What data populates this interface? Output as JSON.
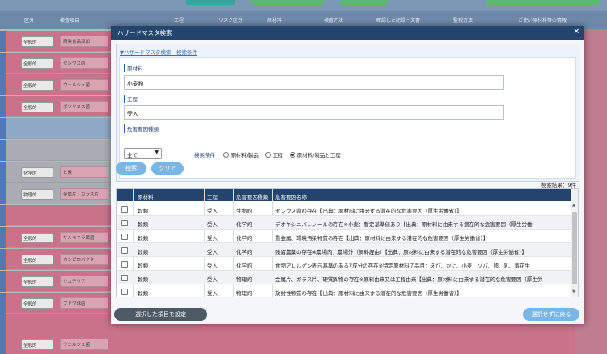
{
  "background": {
    "header_cols": [
      "区分",
      "検査項目",
      "工程",
      "リスク区分",
      "原材料",
      "検査方法",
      "確認した記録・文書",
      "監視方法",
      "ご使い原材料等の情報"
    ],
    "rows": [
      {
        "select": "全般的",
        "cell": "商業食品添加"
      },
      {
        "select": "全般的",
        "cell": "セレウス菌"
      },
      {
        "select": "全般的",
        "cell": "ウェルシュ菌"
      },
      {
        "select": "全般的",
        "cell": "ボツリヌス菌"
      },
      {
        "select": "化学的",
        "cell": "ヒ素"
      },
      {
        "select": "物理的",
        "cell": "金属片・ガラス片"
      },
      {
        "select": "全般的",
        "cell": "サルモネラ属菌"
      },
      {
        "select": "全般的",
        "cell": "カンピロバクター"
      },
      {
        "select": "全般的",
        "cell": "リステリア"
      },
      {
        "select": "全般的",
        "cell": "ブドウ球菌"
      },
      {
        "select": "全般的",
        "cell": "ウェルシュ菌"
      }
    ]
  },
  "dialog": {
    "title": "ハザードマスタ検索",
    "close": "×",
    "cond_toggle": "▼ハザードマスタ検索　検索条件",
    "material_label": "原材料",
    "material_value": "小麦粉",
    "process_label": "工程",
    "process_value": "受入",
    "hazard_type_label": "危害要因種類",
    "hazard_type_value": "全て",
    "search_cond_label": "検索条件",
    "radios": [
      {
        "label": "原材料/製品",
        "checked": false
      },
      {
        "label": "工程",
        "checked": false
      },
      {
        "label": "原材料/製品と工程",
        "checked": true
      }
    ],
    "search_button": "検索",
    "clear_button": "クリア",
    "result_count": "検索結果：9件",
    "table": {
      "headers": [
        "",
        "原材料",
        "工程",
        "危害要因種類",
        "危害要因名称"
      ],
      "rows": [
        {
          "material": "穀類",
          "process": "受入",
          "type": "生物的",
          "name": "セレウス菌の存在【出典：原材料に由来する潜在的な危害要因（厚生労働省）】"
        },
        {
          "material": "穀類",
          "process": "受入",
          "type": "化学的",
          "name": "デオキシニバレノールの存在※小麦：暫定基準値あり【出典：原材料に由来する潜在的な危害要因（厚生労働"
        },
        {
          "material": "穀類",
          "process": "受入",
          "type": "化学的",
          "name": "重金属、環境汚染物質の存在【出典：原材料に由来する潜在的な危害要因（厚生労働省）】"
        },
        {
          "material": "穀類",
          "process": "受入",
          "type": "化学的",
          "name": "残留農薬の存在※農場内、農場外（飼料経由）【出典：原材料に由来する潜在的な危害要因（厚生労働省）】"
        },
        {
          "material": "穀類",
          "process": "受入",
          "type": "化学的",
          "name": "食物アレルゲン表示基準のある7成分の存在※特定原材料７品目：えび、かに、小麦、ソバ、卵、乳、落花生"
        },
        {
          "material": "穀類",
          "process": "受入",
          "type": "物理的",
          "name": "金属片、ガラス片、硬質異物の存在※原料由来又は工程由来【出典：原材料に由来する潜在的な危害要因（厚生労"
        },
        {
          "material": "穀類",
          "process": "受入",
          "type": "物理的",
          "name": "放射性物質の存在【出典：原材料に由来する潜在的な危害要因（厚生労働省）】"
        }
      ]
    },
    "set_button": "選択した項目を設定",
    "back_button": "選択せずに戻る"
  }
}
